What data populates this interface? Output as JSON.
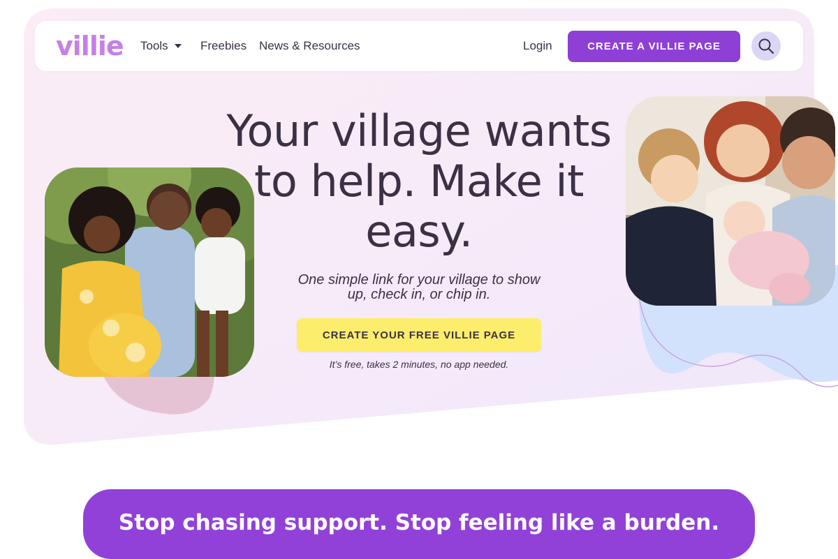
{
  "brand": {
    "logo_text": "villie",
    "accent": "#8e3fd6",
    "logo_color": "#c680e8"
  },
  "nav": {
    "tools_label": "Tools",
    "freebies_label": "Freebies",
    "news_label": "News & Resources",
    "login_label": "Login",
    "create_page_label": "CREATE A VILLIE PAGE",
    "search_icon": "search-icon"
  },
  "hero": {
    "headline": "Your village wants to help. Make it easy.",
    "subhead": "One simple link for your village to show up, check in, or chip in.",
    "cta_label": "CREATE YOUR FREE VILLIE PAGE",
    "note": "It’s free, takes 2 minutes, no app needed.",
    "cta_color": "#fded6c"
  },
  "banner": {
    "text": "Stop chasing support. Stop feeling like a burden.",
    "color": "#9141d8"
  }
}
